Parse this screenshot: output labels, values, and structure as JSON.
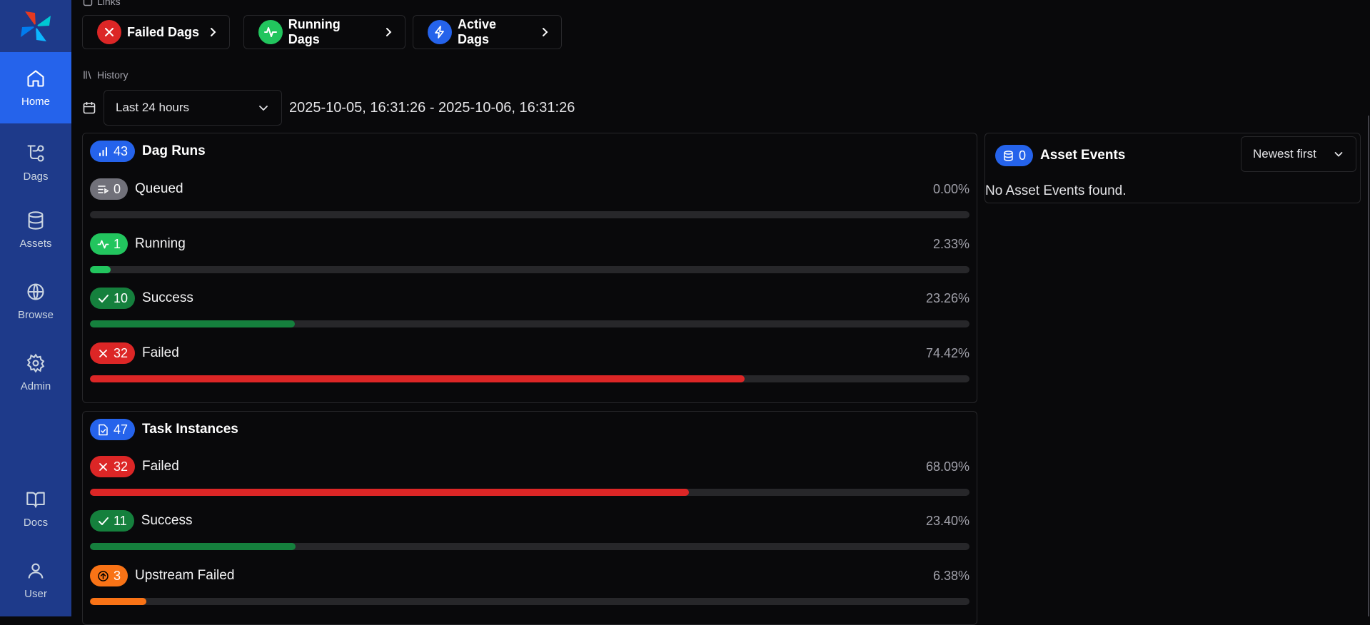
{
  "nav": {
    "items": [
      {
        "label": "Home",
        "icon": "home-icon",
        "active": true
      },
      {
        "label": "Dags",
        "icon": "dags-icon"
      },
      {
        "label": "Assets",
        "icon": "database-icon"
      },
      {
        "label": "Browse",
        "icon": "globe-icon"
      },
      {
        "label": "Admin",
        "icon": "gear-icon"
      },
      {
        "label": "Docs",
        "icon": "book-icon"
      },
      {
        "label": "User",
        "icon": "user-icon"
      }
    ]
  },
  "links": {
    "label": "Links",
    "buttons": [
      {
        "label": "Failed Dags",
        "color": "#dc2626",
        "icon": "x-icon"
      },
      {
        "label": "Running Dags",
        "color": "#22c55e",
        "icon": "activity-icon"
      },
      {
        "label": "Active Dags",
        "color": "#2563eb",
        "icon": "zap-icon"
      }
    ]
  },
  "history": {
    "label": "History",
    "range_select": "Last 24 hours",
    "date_range": "2025-10-05, 16:31:26 - 2025-10-06, 16:31:26"
  },
  "dag_runs": {
    "title": "Dag Runs",
    "count": "43",
    "rows": [
      {
        "label": "Queued",
        "count": "0",
        "pct": "0.00%",
        "fraction": 0.0,
        "color": "#71717a"
      },
      {
        "label": "Running",
        "count": "1",
        "pct": "2.33%",
        "fraction": 0.0233,
        "color": "#22c55e"
      },
      {
        "label": "Success",
        "count": "10",
        "pct": "23.26%",
        "fraction": 0.2326,
        "color": "#15803d"
      },
      {
        "label": "Failed",
        "count": "32",
        "pct": "74.42%",
        "fraction": 0.7442,
        "color": "#dc2626"
      }
    ]
  },
  "task_instances": {
    "title": "Task Instances",
    "count": "47",
    "rows": [
      {
        "label": "Failed",
        "count": "32",
        "pct": "68.09%",
        "fraction": 0.6809,
        "color": "#dc2626"
      },
      {
        "label": "Success",
        "count": "11",
        "pct": "23.40%",
        "fraction": 0.234,
        "color": "#15803d"
      },
      {
        "label": "Upstream Failed",
        "count": "3",
        "pct": "6.38%",
        "fraction": 0.0638,
        "color": "#f97316"
      }
    ]
  },
  "asset_events": {
    "title": "Asset Events",
    "count": "0",
    "sort_label": "Newest first",
    "empty_message": "No Asset Events found."
  }
}
